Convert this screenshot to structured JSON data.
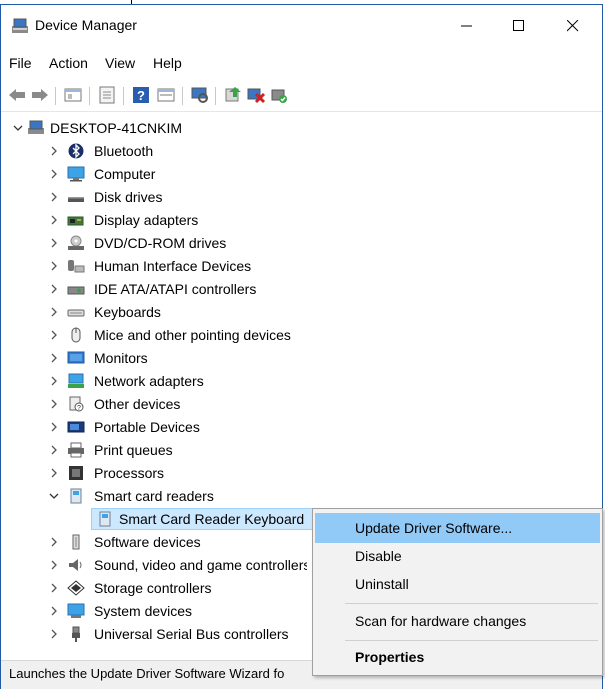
{
  "window": {
    "title": "Device Manager"
  },
  "menubar": [
    "File",
    "Action",
    "View",
    "Help"
  ],
  "tree": {
    "root": "DESKTOP-41CNKIM",
    "categories": [
      "Bluetooth",
      "Computer",
      "Disk drives",
      "Display adapters",
      "DVD/CD-ROM drives",
      "Human Interface Devices",
      "IDE ATA/ATAPI controllers",
      "Keyboards",
      "Mice and other pointing devices",
      "Monitors",
      "Network adapters",
      "Other devices",
      "Portable Devices",
      "Print queues",
      "Processors",
      "Smart card readers",
      "Smart Card Reader Keyboard",
      "Software devices",
      "Sound, video and game controllers",
      "Storage controllers",
      "System devices",
      "Universal Serial Bus controllers"
    ]
  },
  "context_menu": {
    "items": [
      "Update Driver Software...",
      "Disable",
      "Uninstall",
      "Scan for hardware changes",
      "Properties"
    ]
  },
  "statusbar": {
    "text": "Launches the Update Driver Software Wizard fo"
  },
  "colors": {
    "selection_bg": "#cce8ff",
    "menu_highlight": "#91c9f7",
    "window_border": "#1e5aa8"
  }
}
